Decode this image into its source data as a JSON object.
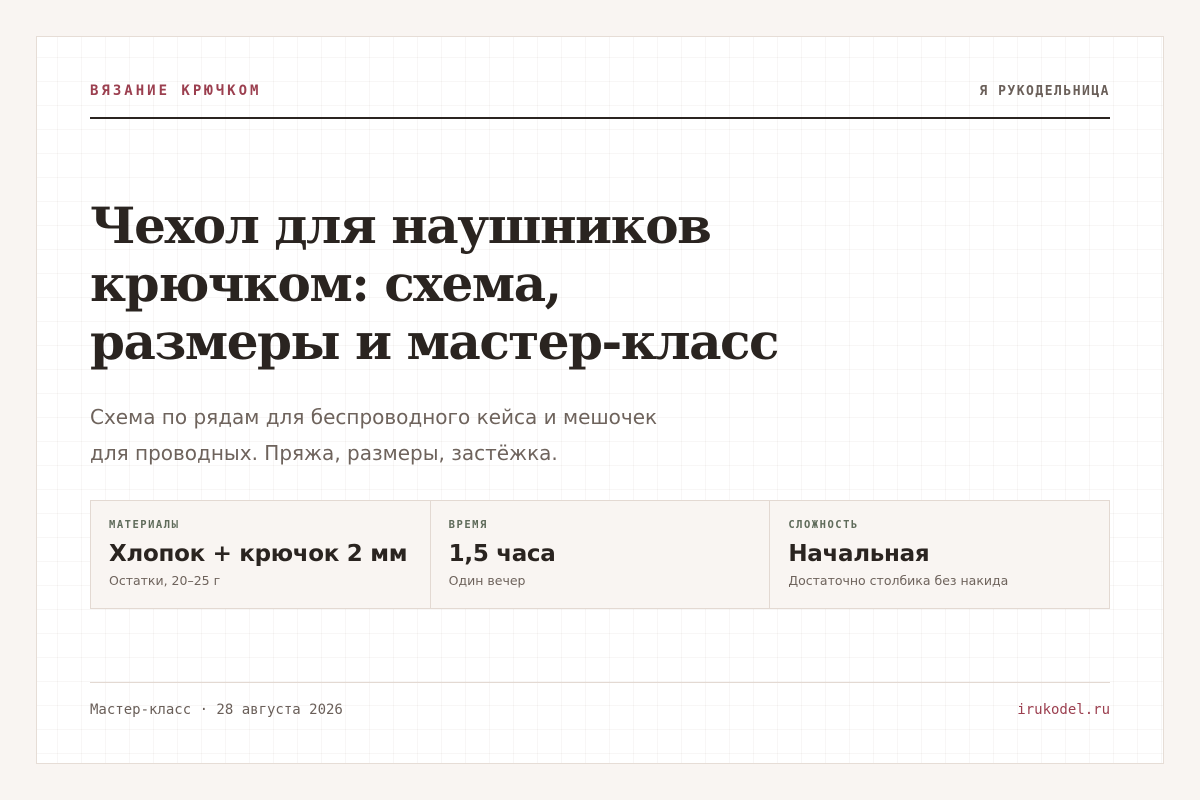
{
  "header": {
    "kicker": "ВЯЗАНИЕ КРЮЧКОМ",
    "brand": "Я РУКОДЕЛЬНИЦА"
  },
  "article": {
    "title_lines": [
      "Чехол для наушников",
      "крючком: схема,",
      "размеры и мастер-класс"
    ],
    "subtitle_lines": [
      "Схема по рядам для беспроводного кейса и мешочек",
      "для проводных. Пряжа, размеры, застёжка."
    ]
  },
  "facts": [
    {
      "label": "МАТЕРИАЛЫ",
      "value": "Хлопок + крючок 2 мм",
      "note": "Остатки, 20–25 г"
    },
    {
      "label": "ВРЕМЯ",
      "value": "1,5 часа",
      "note": "Один вечер"
    },
    {
      "label": "СЛОЖНОСТЬ",
      "value": "Начальная",
      "note": "Достаточно столбика без накида"
    }
  ],
  "footer": {
    "meta": "Мастер-класс · 28 августа 2026",
    "site": "irukodel.ru"
  },
  "colors": {
    "accent": "#9b3f4f",
    "ink": "#2a2420",
    "muted": "#6e635c",
    "label": "#5f6b5a",
    "panel": "#f9f5f2"
  }
}
